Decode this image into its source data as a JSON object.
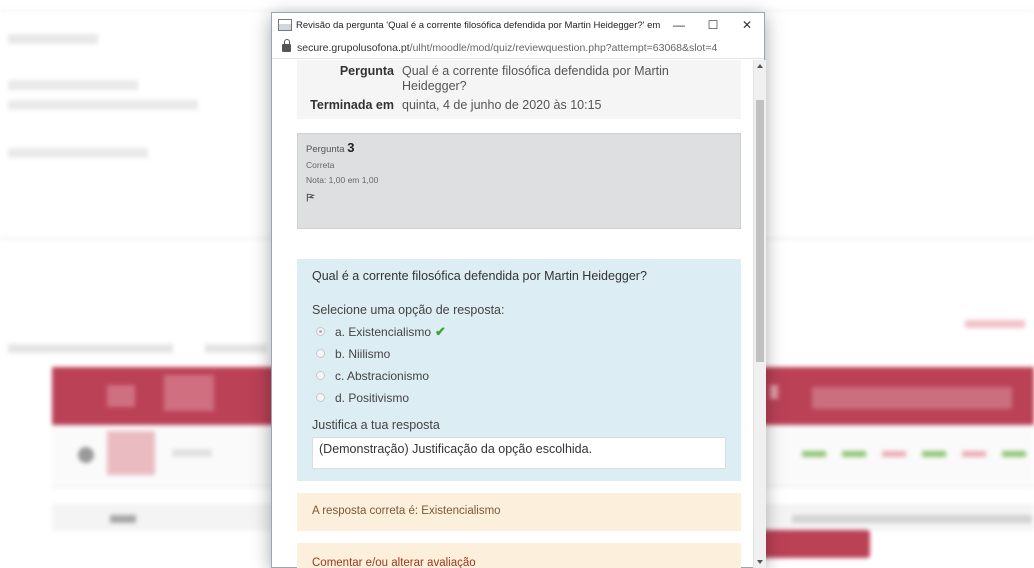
{
  "popup": {
    "title": "Revisão da pergunta 'Qual é a corrente filosófica defendida por Martin Heidegger?' em 'Teste de...",
    "url_host": "secure.grupolusofona.pt",
    "url_path": "/ulht/moodle/mod/quiz/reviewquestion.php?attempt=63068&slot=4",
    "min_glyph": "—",
    "max_glyph": "☐",
    "close_glyph": "✕"
  },
  "summary": {
    "question_label": "Pergunta",
    "question_value": "Qual é a corrente filosófica defendida por Martin Heidegger?",
    "finished_label": "Terminada em",
    "finished_value": "quinta, 4 de junho de 2020 às 10:15"
  },
  "info": {
    "question_word": "Pergunta",
    "question_number": "3",
    "state": "Correta",
    "grade": "Nota: 1,00 em 1,00"
  },
  "formulation": {
    "question_text": "Qual é a corrente filosófica defendida por Martin Heidegger?",
    "prompt": "Selecione uma opção de resposta:",
    "options": [
      {
        "label": "a. Existencialismo",
        "selected": true,
        "correct_mark": "✔"
      },
      {
        "label": "b. Niilismo",
        "selected": false
      },
      {
        "label": "c. Abstracionismo",
        "selected": false
      },
      {
        "label": "d. Positivismo",
        "selected": false
      }
    ],
    "justify_label": "Justifica a tua resposta",
    "justify_value": "(Demonstração) Justificação da opção escolhida."
  },
  "outcome": {
    "right_answer": "A resposta correta é: Existencialismo"
  },
  "comment": {
    "link": "Comentar e/ou alterar avaliação"
  },
  "colors": {
    "header_red": "#b0213a",
    "formulation_bg": "#dcedf4",
    "outcome_bg": "#fcefdc",
    "correct_green": "#3aa53a"
  }
}
